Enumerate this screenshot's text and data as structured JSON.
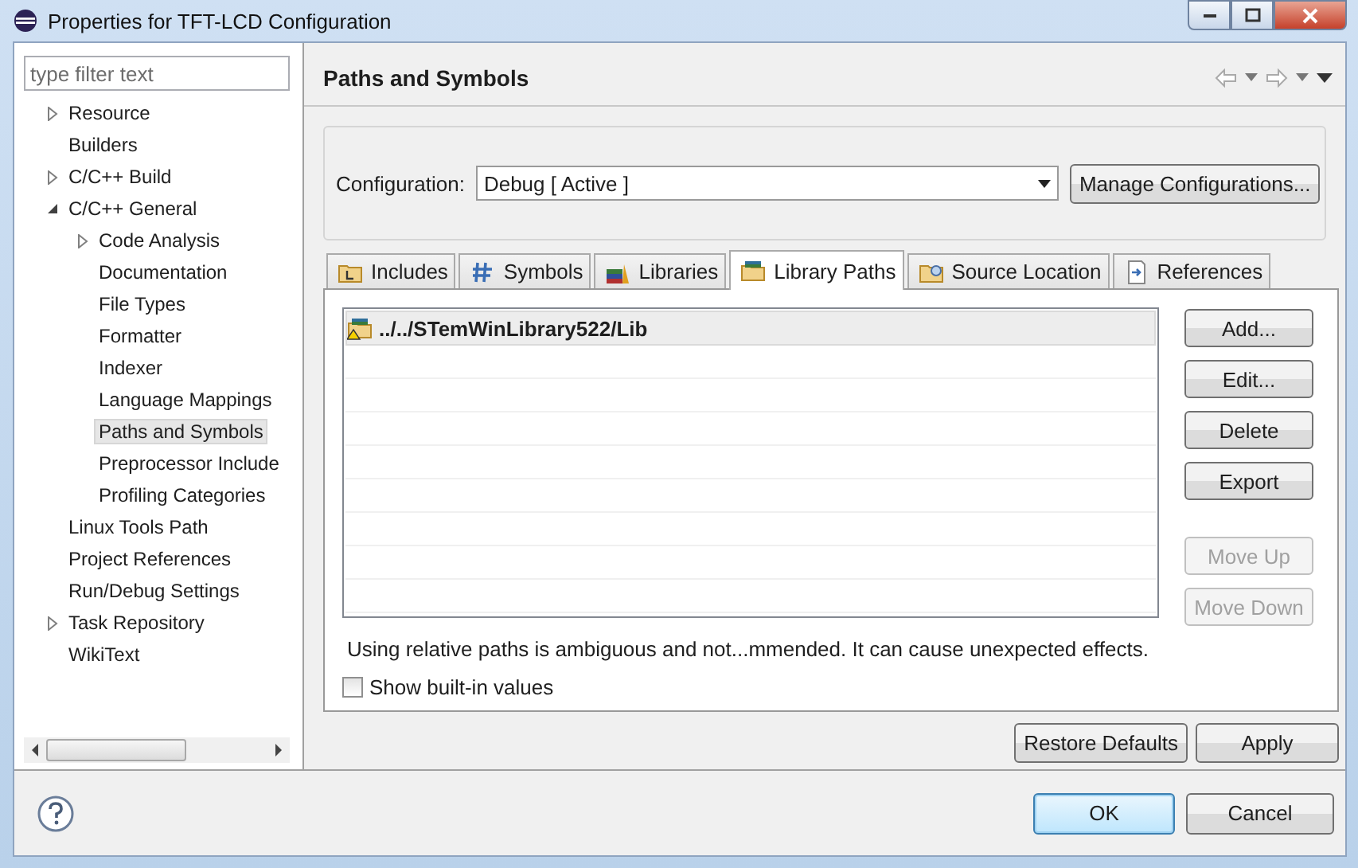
{
  "window": {
    "title": "Properties for TFT-LCD Configuration"
  },
  "filter": {
    "placeholder": "type filter text"
  },
  "tree": [
    {
      "label": "Resource",
      "expanded": false,
      "selected": false
    },
    {
      "label": "Builders",
      "selected": false
    },
    {
      "label": "C/C++ Build",
      "expanded": false,
      "selected": false
    },
    {
      "label": "C/C++ General",
      "expanded": true,
      "selected": false,
      "children": [
        {
          "label": "Code Analysis",
          "expanded": false,
          "selected": false
        },
        {
          "label": "Documentation",
          "selected": false
        },
        {
          "label": "File Types",
          "selected": false
        },
        {
          "label": "Formatter",
          "selected": false
        },
        {
          "label": "Indexer",
          "selected": false
        },
        {
          "label": "Language Mappings",
          "selected": false
        },
        {
          "label": "Paths and Symbols",
          "selected": true
        },
        {
          "label": "Preprocessor Include",
          "selected": false
        },
        {
          "label": "Profiling Categories",
          "selected": false
        }
      ]
    },
    {
      "label": "Linux Tools Path",
      "selected": false
    },
    {
      "label": "Project References",
      "selected": false
    },
    {
      "label": "Run/Debug Settings",
      "selected": false
    },
    {
      "label": "Task Repository",
      "expanded": false,
      "selected": false
    },
    {
      "label": "WikiText",
      "selected": false
    }
  ],
  "page": {
    "title": "Paths and Symbols",
    "configuration": {
      "label": "Configuration:",
      "value": "Debug  [ Active ]",
      "button": "Manage Configurations..."
    },
    "tabs": [
      {
        "label": "Includes",
        "selected": false
      },
      {
        "label": "Symbols",
        "selected": false
      },
      {
        "label": "Libraries",
        "selected": false
      },
      {
        "label": "Library Paths",
        "selected": true
      },
      {
        "label": "Source Location",
        "selected": false
      },
      {
        "label": "References",
        "selected": false
      }
    ],
    "paths": [
      {
        "text": "../../STemWinLibrary522/Lib",
        "selected": true
      }
    ],
    "buttons": [
      {
        "label": "Add...",
        "disabled": false
      },
      {
        "label": "Edit...",
        "disabled": false
      },
      {
        "label": "Delete",
        "disabled": false
      },
      {
        "label": "Export",
        "disabled": false
      },
      {
        "label": "Move Up",
        "disabled": true
      },
      {
        "label": "Move Down",
        "disabled": true
      }
    ],
    "message": "Using relative paths is ambiguous and not...mmended. It can cause unexpected effects.",
    "show_builtin": {
      "label": "Show built-in values",
      "checked": false
    },
    "restore_button": "Restore Defaults",
    "apply_button": "Apply"
  },
  "footer": {
    "ok": "OK",
    "cancel": "Cancel"
  }
}
